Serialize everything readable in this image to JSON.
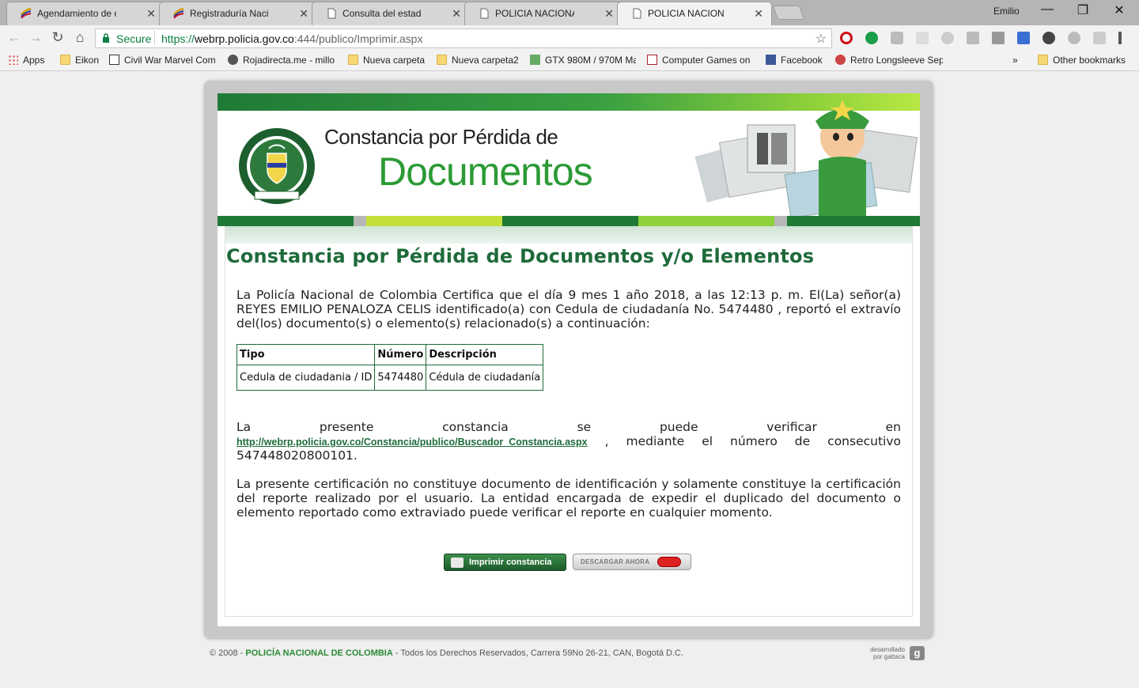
{
  "browser": {
    "tabs": [
      {
        "title": "Agendamiento de citas -",
        "icon": "colombia-flag-icon"
      },
      {
        "title": "Registraduría Nacional d",
        "icon": "colombia-flag-icon"
      },
      {
        "title": "Consulta del estado de sı",
        "icon": "page-icon"
      },
      {
        "title": "POLICIA NACIONAL - Co",
        "icon": "page-icon"
      },
      {
        "title": "POLICIA NACIONAL - Co",
        "icon": "page-icon",
        "active": true
      }
    ],
    "profile": "Emilio",
    "secure_label": "Secure",
    "url_scheme": "https://",
    "url_host": "webrp.policia.gov.co",
    "url_rest": ":444/publico/Imprimir.aspx",
    "bookmarks": [
      "Apps",
      "Eikon",
      "Civil War Marvel Com",
      "Rojadirecta.me - millo",
      "Nueva carpeta",
      "Nueva carpeta2",
      "GTX 980M / 970M Ma",
      "Computer Games on",
      "Facebook",
      "Retro Longsleeve Sep"
    ],
    "other_bookmarks": "Other bookmarks",
    "overflow": "»"
  },
  "banner": {
    "title_small": "Constancia por Pérdida de",
    "title_big": "Documentos",
    "seal_text": "REPÚBLICA DE COLOMBIA · POLICÍA NACIONAL",
    "seal_motto": "DIOS Y PATRIA"
  },
  "page": {
    "title": "Constancia por Pérdida de Documentos y/o Elementos",
    "intro": "La Policía Nacional de Colombia Certifica que el día 9 mes 1 año 2018, a las 12:13 p. m.  El(La) señor(a) REYES EMILIO PENALOZA CELIS  identificado(a) con Cedula de ciudadanía  No. 5474480 , reportó el extravío del(los) documento(s) o elemento(s) relacionado(s) a continuación:",
    "table": {
      "headers": [
        "Tipo",
        "Número",
        "Descripción"
      ],
      "rows": [
        [
          "Cedula de ciudadania / ID",
          "5474480",
          "Cédula de ciudadanía"
        ]
      ]
    },
    "verify_before": "La presente constancia se puede verificar en",
    "verify_link": "http://webrp.policia.gov.co/Constancia/publico/Buscador_Constancia.aspx",
    "verify_after": " , mediante el número de consecutivo",
    "consecutivo": "547448020800101.",
    "disclaimer": "La presente certificación no constituye documento de identificación y solamente constituye la certificación del reporte realizado por el usuario. La entidad encargada de expedir el duplicado del documento o elemento reportado como extraviado puede verificar el reporte en cualquier momento.",
    "print_button": "Imprimir constancia",
    "download_button": "DESCARGAR AHORA"
  },
  "footer": {
    "prefix": "© 2008 - ",
    "brand": "POLICÍA NACIONAL DE COLOMBIA",
    "rest": " - Todos los Derechos Reservados, Carrera 59No 26-21, CAN, Bogotá D.C.",
    "dev_line1": "desarrollado",
    "dev_line2": "por gattaca",
    "dev_logo": "g"
  },
  "colors": {
    "police_green": "#1e6b3a",
    "banner_green": "#2c9a35",
    "lime": "#b8e844"
  }
}
